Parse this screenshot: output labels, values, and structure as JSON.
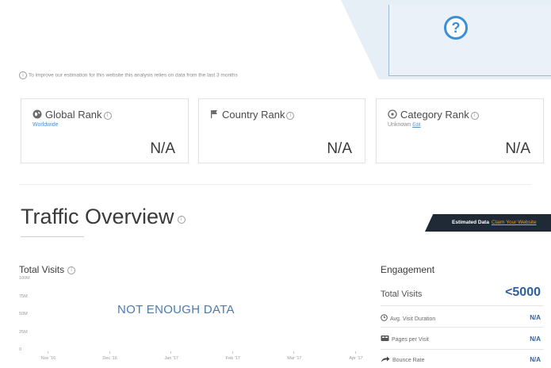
{
  "hero": {
    "icon": "question-mark-icon"
  },
  "note": {
    "text": "To improve our estimation for this website this analysis relies on data from the last 3 months",
    "icon": "info-icon"
  },
  "ranks": [
    {
      "title": "Global Rank",
      "subtitle": "Worldwide",
      "value": "N/A",
      "icon": "globe-icon"
    },
    {
      "title": "Country Rank",
      "subtitle": "",
      "value": "N/A",
      "icon": "flag-icon"
    },
    {
      "title": "Category Rank",
      "subtitle": "Unknown",
      "edit": "Edit",
      "value": "N/A",
      "icon": "category-icon"
    }
  ],
  "traffic": {
    "title": "Traffic Overview",
    "banner": {
      "label": "Estimated Data",
      "link": "Claim Your Website"
    }
  },
  "visits_chart": {
    "title": "Total Visits",
    "no_data": "NOT ENOUGH DATA"
  },
  "chart_data": {
    "type": "line",
    "title": "Total Visits",
    "y_ticks": [
      "100M",
      "75M",
      "50M",
      "25M",
      "0"
    ],
    "x_ticks": [
      "Nov '16",
      "Dec '16",
      "Jan '17",
      "Feb '17",
      "Mar '17",
      "Apr '17"
    ],
    "ylim": [
      0,
      100000000
    ],
    "series": [],
    "annotation": "NOT ENOUGH DATA"
  },
  "engagement": {
    "title": "Engagement",
    "total_visits_label": "Total Visits",
    "total_visits_value": "<5000",
    "rows": [
      {
        "label": "Avg. Visit Duration",
        "value": "N/A",
        "icon": "clock-icon"
      },
      {
        "label": "Pages per Visit",
        "value": "N/A",
        "icon": "pages-icon"
      },
      {
        "label": "Bounce Rate",
        "value": "N/A",
        "icon": "bounce-arrow-icon"
      }
    ]
  },
  "colors": {
    "accent": "#3b8fd6",
    "link": "#4a90d9",
    "banner_bg": "#1f2a36",
    "claim": "#f29b1c",
    "value_blue": "#2c5f9e"
  }
}
